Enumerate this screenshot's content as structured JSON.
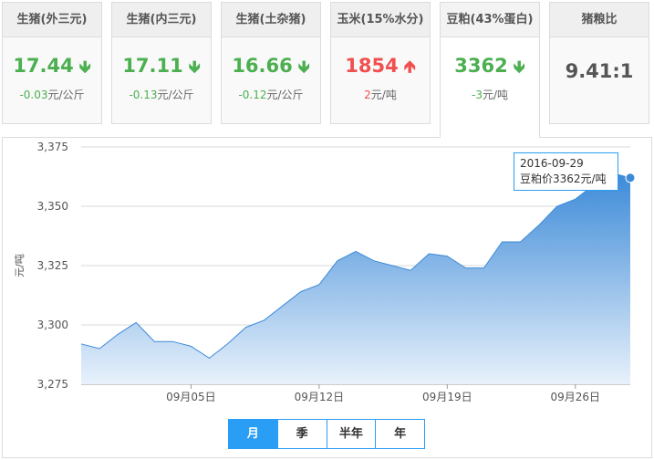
{
  "cards": [
    {
      "title": "生猪(外三元)",
      "value": "17.44",
      "direction": "down",
      "delta": "-0.03",
      "unit": "元/公斤"
    },
    {
      "title": "生猪(内三元)",
      "value": "17.11",
      "direction": "down",
      "delta": "-0.13",
      "unit": "元/公斤"
    },
    {
      "title": "生猪(土杂猪)",
      "value": "16.66",
      "direction": "down",
      "delta": "-0.12",
      "unit": "元/公斤"
    },
    {
      "title": "玉米(15%水分)",
      "value": "1854",
      "direction": "up",
      "delta": "2",
      "unit": "元/吨"
    },
    {
      "title": "豆粕(43%蛋白)",
      "value": "3362",
      "direction": "down",
      "delta": "-3",
      "unit": "元/吨"
    },
    {
      "title": "猪粮比",
      "value": "9.41:1"
    }
  ],
  "arrows": {
    "down": "🡻",
    "up": "🡹"
  },
  "tooltip": {
    "date": "2016-09-29",
    "text": "豆粕价3362元/吨"
  },
  "tabs": [
    {
      "label": "月",
      "active": true
    },
    {
      "label": "季",
      "active": false
    },
    {
      "label": "半年",
      "active": false
    },
    {
      "label": "年",
      "active": false
    }
  ],
  "colors": {
    "line": "#3c8ad8",
    "fill_top": "#3c8ad8",
    "fill_bottom": "#e8f1fb",
    "accent": "#2a9df4",
    "down": "#4caf50",
    "up": "#f05050"
  },
  "chart_data": {
    "type": "area",
    "ylabel": "元/吨",
    "ylim": [
      3275,
      3375
    ],
    "yticks": [
      3275,
      3300,
      3325,
      3350,
      3375
    ],
    "ytick_labels": [
      "3,275",
      "3,300",
      "3,325",
      "3,350",
      "3,375"
    ],
    "xtick_labels": [
      "09月05日",
      "09月12日",
      "09月19日",
      "09月26日"
    ],
    "xtick_index": [
      6,
      13,
      20,
      27
    ],
    "grid": true,
    "series": [
      {
        "dates": [
          "2016-08-30",
          "2016-08-31",
          "2016-09-01",
          "2016-09-02",
          "2016-09-03",
          "2016-09-04",
          "2016-09-05",
          "2016-09-06",
          "2016-09-07",
          "2016-09-08",
          "2016-09-09",
          "2016-09-10",
          "2016-09-11",
          "2016-09-12",
          "2016-09-13",
          "2016-09-14",
          "2016-09-15",
          "2016-09-16",
          "2016-09-17",
          "2016-09-18",
          "2016-09-19",
          "2016-09-20",
          "2016-09-21",
          "2016-09-22",
          "2016-09-23",
          "2016-09-24",
          "2016-09-25",
          "2016-09-26",
          "2016-09-27",
          "2016-09-28",
          "2016-09-29"
        ],
        "values": [
          3292,
          3290,
          3296,
          3301,
          3293,
          3293,
          3291,
          3286,
          3292,
          3299,
          3302,
          3308,
          3314,
          3317,
          3327,
          3331,
          3327,
          3325,
          3323,
          3330,
          3329,
          3324,
          3324,
          3335,
          3335,
          3342,
          3350,
          3353,
          3359,
          3364,
          3362
        ]
      }
    ]
  }
}
